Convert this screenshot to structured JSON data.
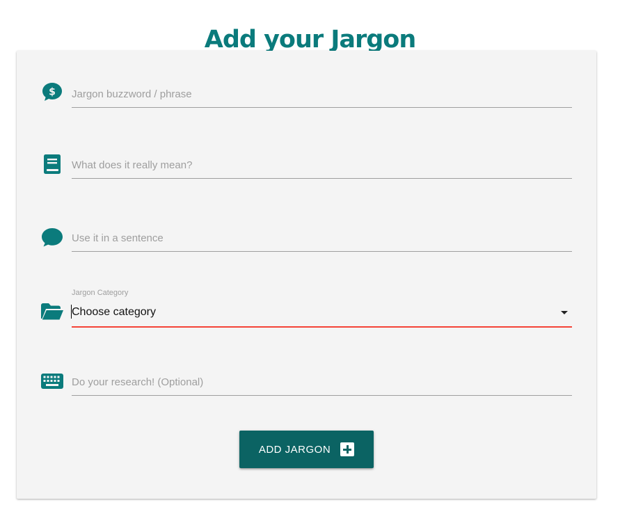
{
  "page": {
    "title": "Add your Jargon"
  },
  "form": {
    "fields": [
      {
        "icon": "dollar-chat-icon",
        "placeholder": "Jargon buzzword / phrase",
        "value": ""
      },
      {
        "icon": "book-icon",
        "placeholder": "What does it really mean?",
        "value": ""
      },
      {
        "icon": "chat-bubble-icon",
        "placeholder": "Use it in a sentence",
        "value": ""
      },
      {
        "icon": "keyboard-icon",
        "placeholder": "Do your research! (Optional)",
        "value": ""
      }
    ],
    "category": {
      "icon": "folder-open-icon",
      "label": "Jargon Category",
      "selected": "Choose category"
    },
    "submit": {
      "label": "ADD JARGON",
      "icon": "plus-box-icon"
    }
  },
  "colors": {
    "accent": "#0b7b7c",
    "button": "#0b6363",
    "error_underline": "#f44336",
    "card_background": "#f4f4f4"
  }
}
